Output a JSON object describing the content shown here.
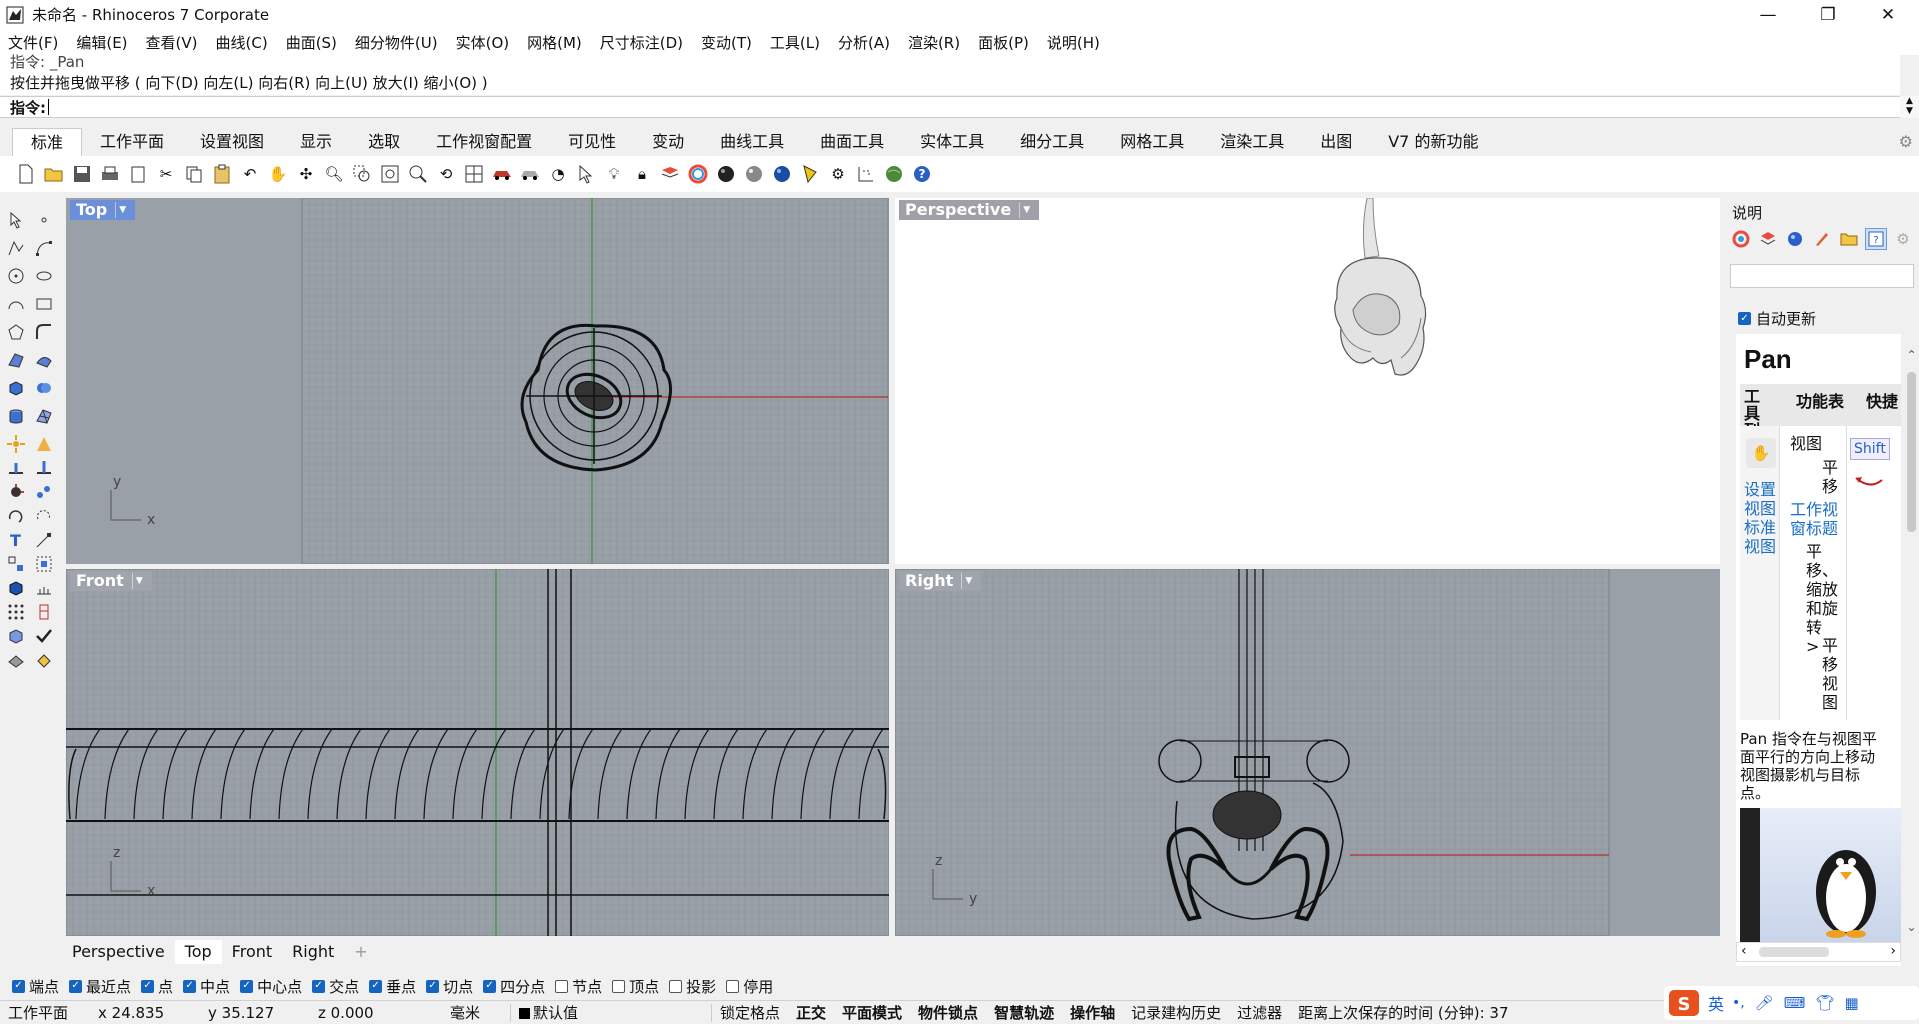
{
  "window": {
    "title": "未命名 - Rhinoceros 7 Corporate",
    "minimize": "—",
    "maximize": "❐",
    "close": "✕"
  },
  "menu": [
    "文件(F)",
    "编辑(E)",
    "查看(V)",
    "曲线(C)",
    "曲面(S)",
    "细分物件(U)",
    "实体(O)",
    "网格(M)",
    "尺寸标注(D)",
    "变动(T)",
    "工具(L)",
    "分析(A)",
    "渲染(R)",
    "面板(P)",
    "说明(H)"
  ],
  "command": {
    "history_prev": "指令: _Pan",
    "history_last": "按住并拖曳做平移 ( 向下(D)  向左(L)  向右(R)  向上(U)  放大(I)  缩小(O) )",
    "prompt": "指令:"
  },
  "tabs": [
    "标准",
    "工作平面",
    "设置视图",
    "显示",
    "选取",
    "工作视窗配置",
    "可见性",
    "变动",
    "曲线工具",
    "曲面工具",
    "实体工具",
    "细分工具",
    "网格工具",
    "渲染工具",
    "出图",
    "V7 的新功能"
  ],
  "viewports": {
    "top": {
      "label": "Top",
      "axis_y": "y",
      "axis_x": "x"
    },
    "perspective": {
      "label": "Perspective"
    },
    "front": {
      "label": "Front",
      "axis_y": "z",
      "axis_x": "x"
    },
    "right": {
      "label": "Right",
      "axis_y": "z",
      "axis_x": "y"
    }
  },
  "view_tabs": [
    "Perspective",
    "Top",
    "Front",
    "Right"
  ],
  "view_tab_add": "+",
  "osnaps": [
    {
      "label": "端点",
      "checked": true
    },
    {
      "label": "最近点",
      "checked": true
    },
    {
      "label": "点",
      "checked": true
    },
    {
      "label": "中点",
      "checked": true
    },
    {
      "label": "中心点",
      "checked": true
    },
    {
      "label": "交点",
      "checked": true
    },
    {
      "label": "垂点",
      "checked": true
    },
    {
      "label": "切点",
      "checked": true
    },
    {
      "label": "四分点",
      "checked": true
    },
    {
      "label": "节点",
      "checked": false
    },
    {
      "label": "顶点",
      "checked": false
    },
    {
      "label": "投影",
      "checked": false
    },
    {
      "label": "停用",
      "checked": false
    }
  ],
  "status": {
    "cplane": "工作平面",
    "x": "x 24.835",
    "y": "y 35.127",
    "z": "z 0.000",
    "units": "毫米",
    "layer": "默认值",
    "grid_snap": "锁定格点",
    "ortho": "正交",
    "planar": "平面模式",
    "osnap": "物件锁点",
    "smarttrack": "智慧轨迹",
    "gumball": "操作轴",
    "history": "记录建构历史",
    "filter": "过滤器",
    "save_time": "距离上次保存的时间 (分钟): 37"
  },
  "help_panel": {
    "title": "说明",
    "auto_update": "自动更新",
    "command_name": "Pan",
    "col_toolbar": "工具列",
    "col_menu": "功能表",
    "col_shortcut": "快捷",
    "link_setview": "设置视图标准视图",
    "menu_view": "视图",
    "menu_pan": "平移",
    "link_vptitle": "工作视窗标题",
    "menu_path": "平移、缩放和旋转 >",
    "menu_panview": "平移视图",
    "shortcut": "Shift",
    "description": "Pan 指令在与视图平面平行的方向上移动视图摄影机与目标点。"
  },
  "ime": {
    "lang": "英",
    "punct": "•,"
  },
  "colors": {
    "viewport_bg": "#9aa0a8",
    "viewport_active_label": "#6b8fd8",
    "grid_line": "#8d939b",
    "axis_x": "#b03030",
    "axis_y": "#2e9a2e",
    "accent": "#1565c0"
  }
}
